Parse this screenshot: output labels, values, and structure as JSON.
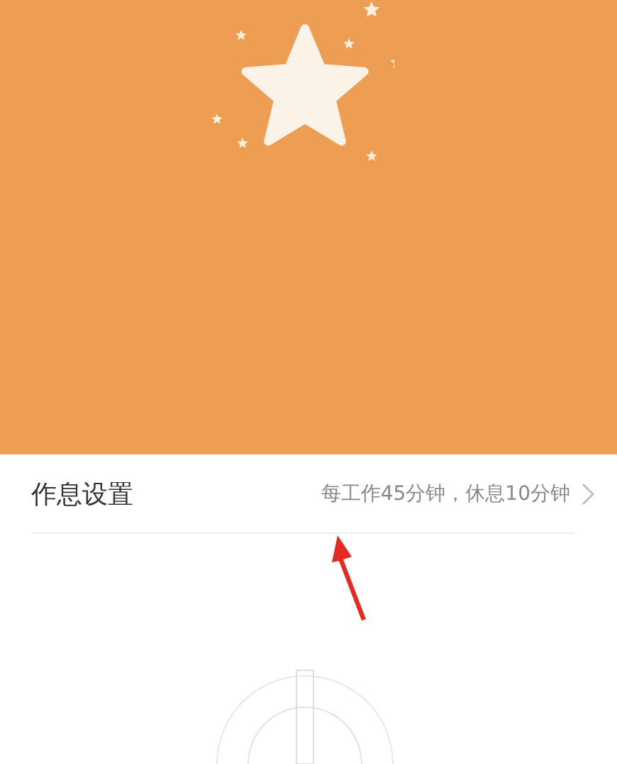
{
  "setting_row": {
    "label": "作息设置",
    "value": "每工作45分钟，休息10分钟"
  }
}
